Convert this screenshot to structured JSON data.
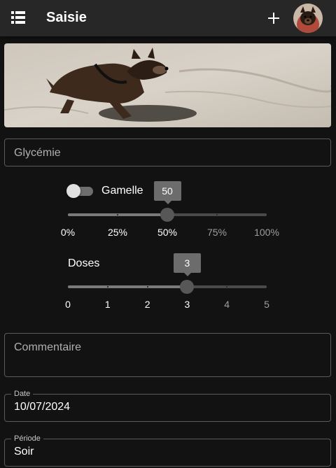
{
  "appbar": {
    "title": "Saisie",
    "menu_icon": "list-icon",
    "add_icon": "plus-icon",
    "avatar": "dog-avatar"
  },
  "banner": {
    "image": "dog-running-on-beach"
  },
  "glycemie": {
    "placeholder": "Glycémie",
    "value": ""
  },
  "gamelle": {
    "label": "Gamelle",
    "enabled": false,
    "value": 50,
    "value_label": "50",
    "min": 0,
    "max": 100,
    "marks": [
      "0%",
      "25%",
      "50%",
      "75%",
      "100%"
    ]
  },
  "doses": {
    "label": "Doses",
    "value": 3,
    "value_label": "3",
    "min": 0,
    "max": 5,
    "marks": [
      "0",
      "1",
      "2",
      "3",
      "4",
      "5"
    ]
  },
  "commentaire": {
    "placeholder": "Commentaire",
    "value": ""
  },
  "date": {
    "label": "Date",
    "value": "10/07/2024"
  },
  "periode": {
    "label": "Période",
    "value": "Soir"
  },
  "colors": {
    "background": "#121212",
    "appbar": "#272727",
    "slider_knob": "#575757",
    "value_bubble": "#6c6c6c"
  }
}
